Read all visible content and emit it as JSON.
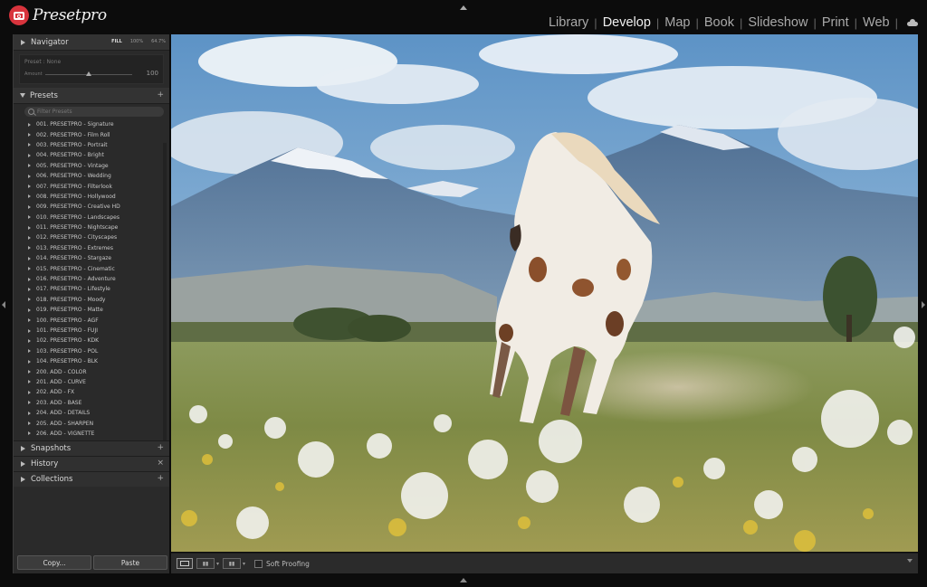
{
  "app": {
    "logo_text": "Presetpro",
    "modules": [
      "Library",
      "Develop",
      "Map",
      "Book",
      "Slideshow",
      "Print",
      "Web"
    ],
    "active_module": "Develop"
  },
  "navigator": {
    "title": "Navigator",
    "zoom": [
      "FILL",
      "100%",
      "64.7%"
    ],
    "preset_name": "Preset : None",
    "amount_label": "Amount",
    "amount_value": "100",
    "amount_fraction": 0.5
  },
  "presets": {
    "title": "Presets",
    "add": "+",
    "search_placeholder": "Filter Presets",
    "items": [
      "001. PRESETPRO - Signature",
      "002. PRESETPRO - Film Roll",
      "003. PRESETPRO - Portrait",
      "004. PRESETPRO - Bright",
      "005. PRESETPRO - Vintage",
      "006. PRESETPRO - Wedding",
      "007. PRESETPRO - Filterlook",
      "008. PRESETPRO - Hollywood",
      "009. PRESETPRO - Creative HD",
      "010. PRESETPRO - Landscapes",
      "011. PRESETPRO - Nightscape",
      "012. PRESETPRO - Cityscapes",
      "013. PRESETPRO - Extremes",
      "014. PRESETPRO - Stargaze",
      "015. PRESETPRO - Cinematic",
      "016. PRESETPRO - Adventure",
      "017. PRESETPRO - Lifestyle",
      "018. PRESETPRO - Moody",
      "019. PRESETPRO - Matte",
      "100. PRESETPRO - AGF",
      "101. PRESETPRO - FUJI",
      "102. PRESETPRO - KDK",
      "103. PRESETPRO - POL",
      "104. PRESETPRO - BLK",
      "200. ADD - COLOR",
      "201. ADD - CURVE",
      "202. ADD - FX",
      "203. ADD - BASE",
      "204. ADD - DETAILS",
      "205. ADD - SHARPEN",
      "206. ADD - VIGNETTE"
    ]
  },
  "lower_panels": [
    {
      "title": "Snapshots",
      "action": "+"
    },
    {
      "title": "History",
      "action": "×"
    },
    {
      "title": "Collections",
      "action": "+"
    }
  ],
  "buttons": {
    "copy": "Copy...",
    "paste": "Paste"
  },
  "toolbar": {
    "soft_proofing": "Soft Proofing"
  },
  "colors": {
    "logo_red": "#d8343d",
    "panel_bg": "#2a2a2a",
    "app_bg": "#0c0c0c"
  }
}
